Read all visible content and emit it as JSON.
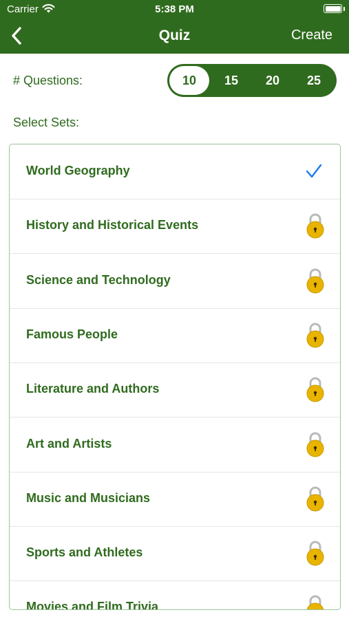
{
  "status_bar": {
    "carrier": "Carrier",
    "time": "5:38 PM"
  },
  "nav": {
    "title": "Quiz",
    "action": "Create"
  },
  "questions": {
    "label": "# Questions:",
    "options": [
      "10",
      "15",
      "20",
      "25"
    ],
    "selected": "10"
  },
  "sets": {
    "label": "Select Sets:",
    "items": [
      {
        "label": "World Geography",
        "status": "checked"
      },
      {
        "label": "History and Historical Events",
        "status": "locked"
      },
      {
        "label": "Science and Technology",
        "status": "locked"
      },
      {
        "label": "Famous People",
        "status": "locked"
      },
      {
        "label": "Literature and Authors",
        "status": "locked"
      },
      {
        "label": "Art and Artists",
        "status": "locked"
      },
      {
        "label": "Music and Musicians",
        "status": "locked"
      },
      {
        "label": "Sports and Athletes",
        "status": "locked"
      },
      {
        "label": "Movies and Film Trivia",
        "status": "locked"
      }
    ]
  },
  "colors": {
    "brand_green": "#2f6b1e",
    "check_blue": "#1a7cf0",
    "lock_gold": "#e9b400"
  }
}
